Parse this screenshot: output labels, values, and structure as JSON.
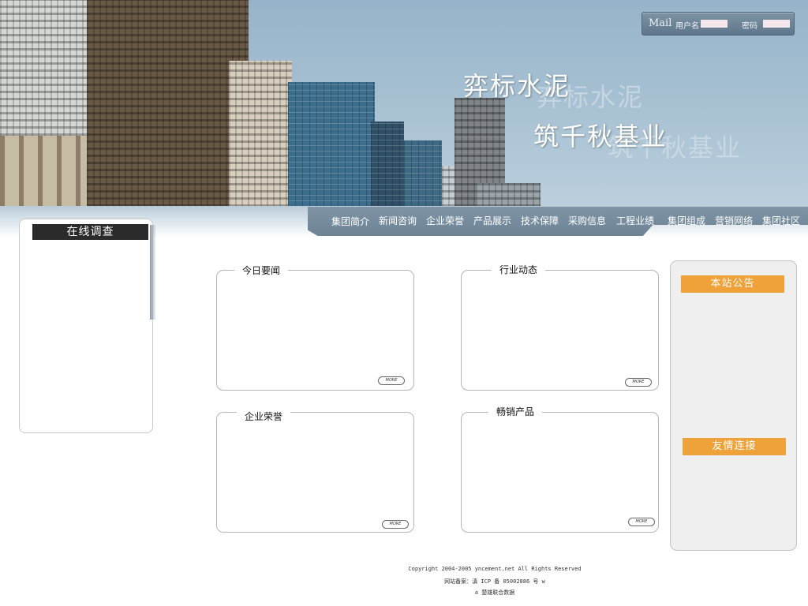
{
  "banner": {
    "title_line1": "弈标水泥",
    "title_line2": "筑千秋基业",
    "sky_color": "#a9c2d4"
  },
  "login": {
    "mail_label": "Mail",
    "username_label": "用户名",
    "password_label": "密码",
    "username_value": "",
    "password_value": ""
  },
  "nav": {
    "items": [
      {
        "label": "集团简介"
      },
      {
        "label": "新闻咨询"
      },
      {
        "label": "企业荣誉"
      },
      {
        "label": "产品展示"
      },
      {
        "label": "技术保障"
      },
      {
        "label": "采购信息"
      },
      {
        "label": "工程业绩"
      },
      {
        "label": "集团组成"
      },
      {
        "label": "营销网络"
      },
      {
        "label": "集团社区"
      }
    ],
    "bar_color": "#75899b"
  },
  "survey": {
    "title": "在线调查"
  },
  "boxes": [
    {
      "title": "今日要闻",
      "more": "MORE"
    },
    {
      "title": "行业动态",
      "more": "MORE"
    },
    {
      "title": "企业荣誉",
      "more": "MORE"
    },
    {
      "title": "畅销产品",
      "more": "MORE"
    }
  ],
  "sidebar": {
    "notice_title": "本站公告",
    "links_title": "友情连接",
    "accent_color": "#efa23a"
  },
  "footer": {
    "line1": "Copyright  2004-2005 yncement.net All Rights Reserved",
    "line2": "网站备案：滇 ICP 备 05002886 号 w",
    "line3": "a 楚雄联合数据"
  }
}
